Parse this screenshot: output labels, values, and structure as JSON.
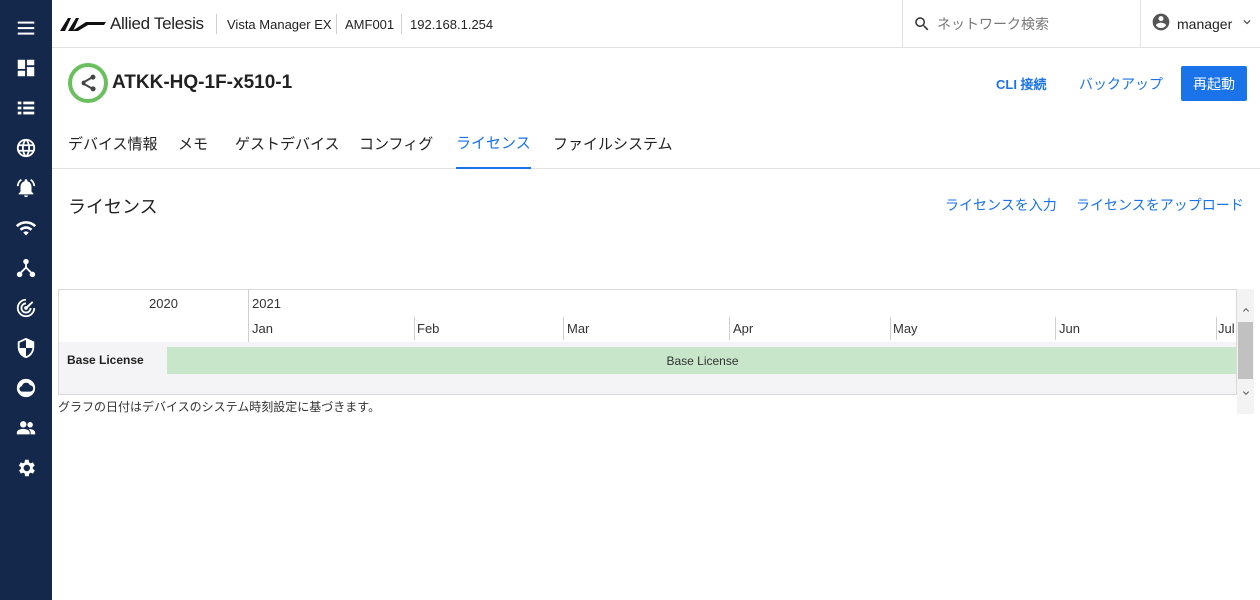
{
  "app": {
    "brand": "Allied Telesis",
    "product": "Vista Manager EX",
    "area": "AMF001",
    "ip": "192.168.1.254"
  },
  "search": {
    "placeholder": "ネットワーク検索"
  },
  "user": {
    "name": "manager"
  },
  "rail": {
    "items": [
      "menu-icon",
      "dashboard-icon",
      "list-icon",
      "globe-icon",
      "alarm-bell-icon",
      "wifi-icon",
      "topology-icon",
      "radar-icon",
      "shield-icon",
      "cloud-icon",
      "users-icon",
      "gear-icon"
    ]
  },
  "device": {
    "name": "ATKK-HQ-1F-x510-1",
    "status_color": "#6cbf5f"
  },
  "actions": {
    "cli": "CLI 接続",
    "backup": "バックアップ",
    "reboot": "再起動"
  },
  "tabs": [
    {
      "label": "デバイス情報"
    },
    {
      "label": "メモ"
    },
    {
      "label": "ゲストデバイス"
    },
    {
      "label": "コンフィグ"
    },
    {
      "label": "ライセンス",
      "active": true
    },
    {
      "label": "ファイルシステム"
    }
  ],
  "license": {
    "title": "ライセンス",
    "enter_link": "ライセンスを入力",
    "upload_link": "ライセンスをアップロード",
    "timeline": {
      "years": [
        "2020",
        "2021"
      ],
      "months": [
        "Jan",
        "Feb",
        "Mar",
        "Apr",
        "May",
        "Jun",
        "Jul"
      ],
      "rows": [
        {
          "label": "Base License",
          "bar_label": "Base License"
        }
      ]
    },
    "note": "グラフの日付はデバイスのシステム時刻設定に基づきます。"
  },
  "colors": {
    "accent": "#1a73e8",
    "rail": "#14284b",
    "bar": "#c8e6c9"
  }
}
